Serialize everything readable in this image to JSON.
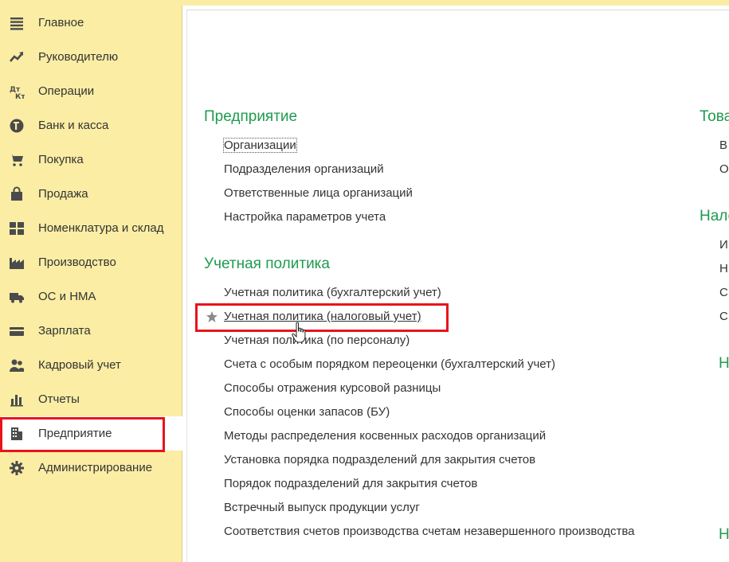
{
  "sidebar": {
    "items": [
      {
        "label": "Главное",
        "icon": "menu-lines-icon"
      },
      {
        "label": "Руководителю",
        "icon": "trend-icon"
      },
      {
        "label": "Операции",
        "icon": "debit-credit-icon"
      },
      {
        "label": "Банк и касса",
        "icon": "ruble-coin-icon"
      },
      {
        "label": "Покупка",
        "icon": "cart-icon"
      },
      {
        "label": "Продажа",
        "icon": "shopping-bag-icon"
      },
      {
        "label": "Номенклатура и склад",
        "icon": "grid-icon"
      },
      {
        "label": "Производство",
        "icon": "factory-icon"
      },
      {
        "label": "ОС и НМА",
        "icon": "truck-icon"
      },
      {
        "label": "Зарплата",
        "icon": "wallet-icon"
      },
      {
        "label": "Кадровый учет",
        "icon": "people-icon"
      },
      {
        "label": "Отчеты",
        "icon": "bar-chart-icon"
      },
      {
        "label": "Предприятие",
        "icon": "building-icon"
      },
      {
        "label": "Администрирование",
        "icon": "gear-icon"
      }
    ],
    "active_index": 12
  },
  "content": {
    "section_enterprise": {
      "title": "Предприятие",
      "links": [
        "Организации",
        "Подразделения организаций",
        "Ответственные лица организаций",
        "Настройка параметров учета"
      ]
    },
    "section_policy": {
      "title": "Учетная политика",
      "links": [
        "Учетная политика (бухгалтерский учет)",
        "Учетная политика (налоговый учет)",
        "Учетная политика (по персоналу)",
        "Счета с особым порядком переоценки (бухгалтерский учет)",
        "Способы отражения курсовой разницы",
        "Способы оценки запасов (БУ)",
        "Методы распределения косвенных расходов организаций",
        "Установка порядка подразделений для закрытия счетов",
        "Порядок подразделений для закрытия счетов",
        "Встречный выпуск продукции услуг",
        "Соответствия счетов производства счетам незавершенного производства"
      ]
    },
    "right_column": {
      "title_1": "Това",
      "items_1": [
        "В",
        "О"
      ],
      "title_2": "Нало",
      "items_2": [
        "И",
        "Н",
        "С",
        "С"
      ],
      "title_3": "Н",
      "title_4": "Н"
    }
  },
  "colors": {
    "sidebar_bg": "#fbeda4",
    "section_title": "#1f9b4f",
    "highlight": "#e8141c"
  }
}
